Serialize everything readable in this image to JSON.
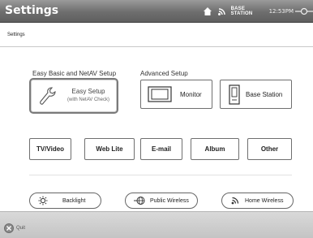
{
  "window": {
    "title": "Settings"
  },
  "status": {
    "base_label": "BASE STATION",
    "clock": "12:53PM"
  },
  "breadcrumb": {
    "label": "Settings"
  },
  "sections": {
    "basic_title": "Easy Basic and NetAV Setup",
    "advanced_title": "Advanced Setup"
  },
  "easy_setup": {
    "line1": "Easy Setup",
    "line2": "(with NetAV Check)"
  },
  "advanced": {
    "monitor": "Monitor",
    "base_station": "Base Station"
  },
  "apps": {
    "tv_video": "TV/Video",
    "web_lite": "Web Lite",
    "email": "E-mail",
    "album": "Album",
    "other": "Other"
  },
  "bottom_buttons": {
    "backlight": "Backlight",
    "public_wireless": "Public Wireless",
    "home_wireless": "Home Wireless"
  },
  "footer": {
    "quit": "Quit"
  }
}
